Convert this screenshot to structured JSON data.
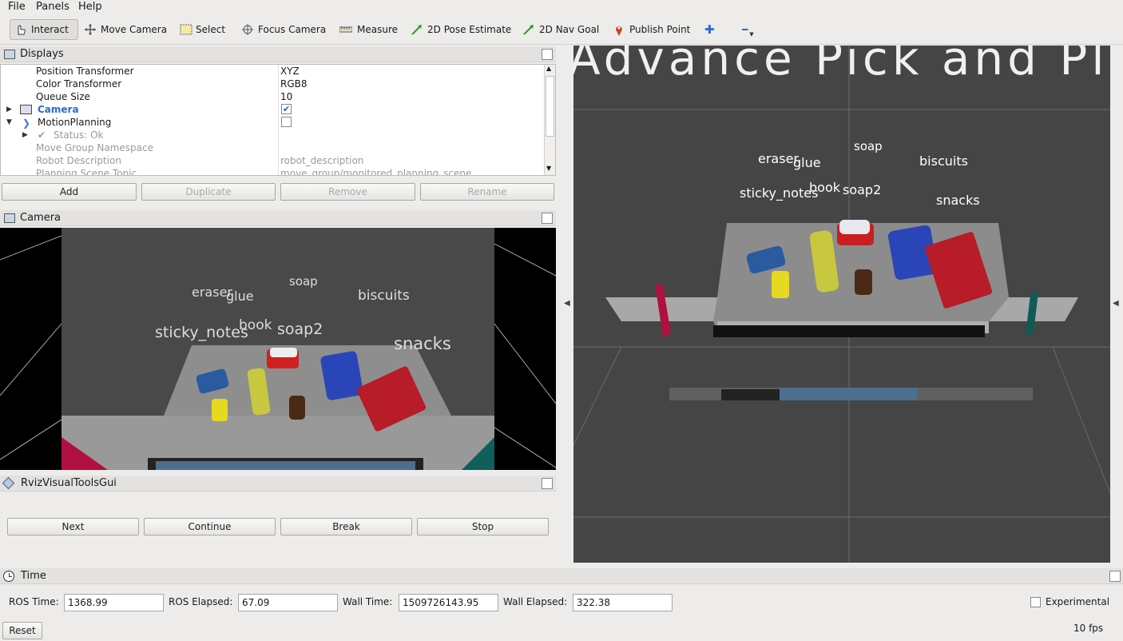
{
  "menu": [
    "File",
    "Panels",
    "Help"
  ],
  "toolbar": {
    "interact": "Interact",
    "move_camera": "Move Camera",
    "select": "Select",
    "focus_camera": "Focus Camera",
    "measure": "Measure",
    "pose_estimate": "2D Pose Estimate",
    "nav_goal": "2D Nav Goal",
    "publish_point": "Publish Point",
    "add_glyph": "✚",
    "remove_glyph": "━"
  },
  "displays": {
    "title": "Displays",
    "rows": [
      {
        "name": "Position Transformer",
        "value": "XYZ"
      },
      {
        "name": "Color Transformer",
        "value": "RGB8"
      },
      {
        "name": "Queue Size",
        "value": "10"
      },
      {
        "name": "Camera",
        "value": ""
      },
      {
        "name": "MotionPlanning",
        "value": ""
      },
      {
        "name": "Status: Ok",
        "value": ""
      },
      {
        "name": "Move Group Namespace",
        "value": ""
      },
      {
        "name": "Robot Description",
        "value": "robot_description"
      },
      {
        "name": "Planning Scene Topic",
        "value": "move_group/monitored_planning_scene"
      }
    ],
    "camera_checked": true,
    "motionplanning_checked": false,
    "buttons": {
      "add": "Add",
      "duplicate": "Duplicate",
      "remove": "Remove",
      "rename": "Rename"
    }
  },
  "camera_panel": {
    "title": "Camera",
    "labels": [
      "eraser",
      "glue",
      "soap",
      "biscuits",
      "sticky_notes",
      "book",
      "soap2",
      "snacks"
    ]
  },
  "rviz_tools": {
    "title": "RvizVisualToolsGui",
    "buttons": {
      "next": "Next",
      "continue": "Continue",
      "break": "Break",
      "stop": "Stop"
    }
  },
  "view3d": {
    "banner": "Advance Pick and Place",
    "labels": [
      "eraser",
      "glue",
      "soap",
      "biscuits",
      "sticky_notes",
      "book",
      "soap2",
      "snacks"
    ]
  },
  "time_panel": {
    "title": "Time",
    "ros_time_label": "ROS Time:",
    "ros_time": "1368.99",
    "ros_elapsed_label": "ROS Elapsed:",
    "ros_elapsed": "67.09",
    "wall_time_label": "Wall Time:",
    "wall_time": "1509726143.95",
    "wall_elapsed_label": "Wall Elapsed:",
    "wall_elapsed": "322.38",
    "experimental": "Experimental",
    "experimental_checked": false,
    "reset": "Reset",
    "fps": "10 fps"
  }
}
